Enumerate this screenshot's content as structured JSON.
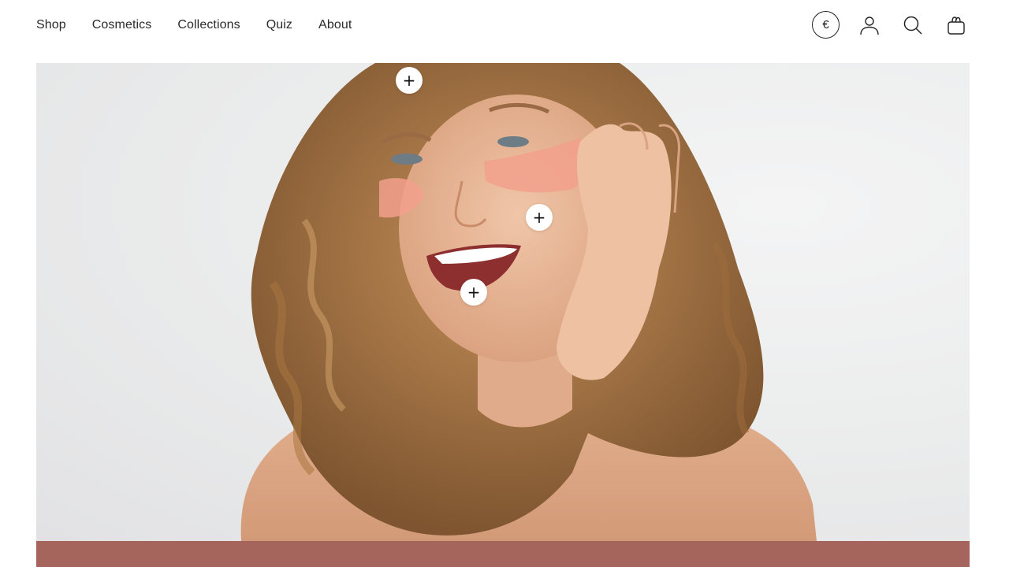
{
  "nav": {
    "items": [
      {
        "label": "Shop"
      },
      {
        "label": "Cosmetics"
      },
      {
        "label": "Collections"
      },
      {
        "label": "Quiz"
      },
      {
        "label": "About"
      }
    ]
  },
  "header_icons": {
    "currency_symbol": "€",
    "account_icon": "user-icon",
    "search_icon": "search-icon",
    "cart_icon": "shopping-bag-icon"
  },
  "hero": {
    "hotspots": [
      {
        "symbol": "+"
      },
      {
        "symbol": "+"
      },
      {
        "symbol": "+"
      }
    ]
  },
  "colors": {
    "band": "#a5655d",
    "text": "#2b2b2b",
    "hero_background": "#ececed"
  }
}
